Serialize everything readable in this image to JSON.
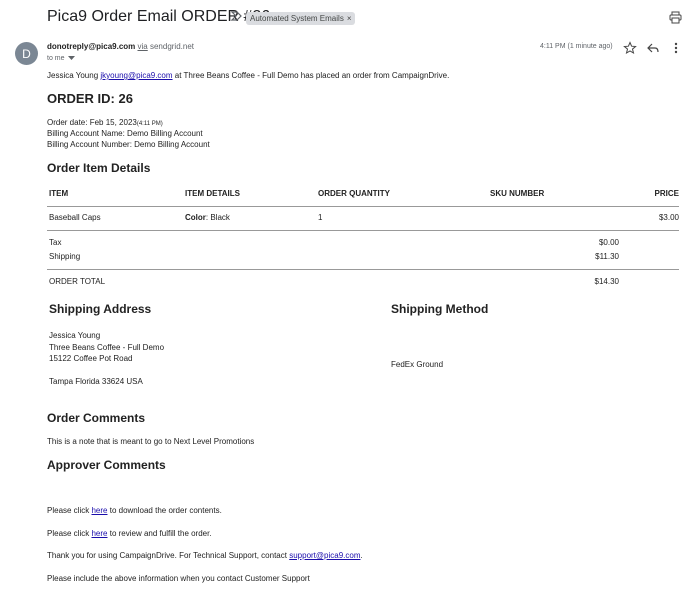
{
  "header": {
    "subject": "Pica9 Order Email ORDER #26",
    "label": "Automated System Emails",
    "label_close": "×"
  },
  "sender": {
    "avatar_letter": "D",
    "email": "donotreply@pica9.com",
    "via_word": "via",
    "via_domain": "sendgrid.net",
    "to": "to me",
    "time": "4:11 PM (1 minute ago)"
  },
  "intro": {
    "name": "Jessica Young",
    "email": "jkyoung@pica9.com",
    "rest": "at Three Beans Coffee - Full Demo has placed an order from CampaignDrive."
  },
  "order": {
    "title": "ORDER ID: 26",
    "date_label": "Order date: Feb 15, 2023",
    "date_time": "(4:11 PM)",
    "billing_name": "Billing Account Name: Demo Billing Account",
    "billing_number": "Billing Account Number: Demo Billing Account"
  },
  "items": {
    "heading": "Order Item Details",
    "columns": [
      "ITEM",
      "ITEM DETAILS",
      "ORDER QUANTITY",
      "SKU NUMBER",
      "PRICE"
    ],
    "rows": [
      {
        "item": "Baseball Caps",
        "detail_key": "Color",
        "detail_value": ": Black",
        "qty": "1",
        "sku": "",
        "price": "$3.00"
      }
    ],
    "tax_label": "Tax",
    "tax_value": "$0.00",
    "shipping_label": "Shipping",
    "shipping_value": "$11.30",
    "total_label": "ORDER TOTAL",
    "total_value": "$14.30"
  },
  "shipping": {
    "address_heading": "Shipping Address",
    "address_lines": [
      "Jessica Young",
      "Three Beans Coffee - Full Demo",
      "15122 Coffee Pot Road",
      "Tampa Florida 33624 USA"
    ],
    "method_heading": "Shipping Method",
    "method_value": "FedEx Ground"
  },
  "comments": {
    "order_heading": "Order Comments",
    "order_text": "This is a note that is meant to go to Next Level Promotions",
    "approver_heading": "Approver Comments"
  },
  "footer": {
    "line1_pre": "Please click",
    "line1_link": "here",
    "line1_post": "to download the order contents.",
    "line2_pre": "Please click",
    "line2_link": "here",
    "line2_post": "to review and fulfill the order.",
    "line3_pre": "Thank you for using CampaignDrive. For Technical Support, contact",
    "line3_link": "support@pica9.com",
    "line3_post": ".",
    "line4": "Please include the above information when you contact Customer Support"
  }
}
